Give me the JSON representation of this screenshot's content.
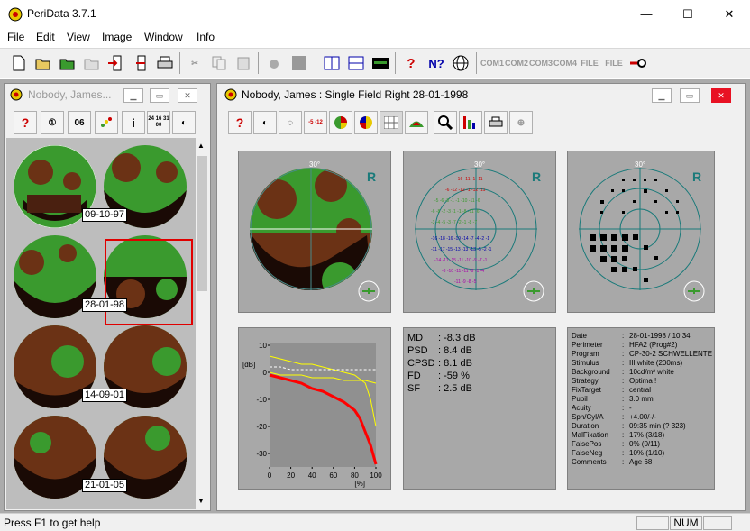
{
  "app": {
    "title": "PeriData 3.7.1"
  },
  "window_buttons": {
    "minimize": "—",
    "maximize": "☐",
    "close": "✕"
  },
  "menu": [
    "File",
    "Edit",
    "View",
    "Image",
    "Window",
    "Info"
  ],
  "toolbar": {
    "buttons": [
      "new",
      "open",
      "open-green",
      "open-disabled",
      "import",
      "export",
      "print",
      "cut",
      "copy",
      "paste",
      "delete",
      "stop",
      "tile-v",
      "tile-h",
      "monitor",
      "help",
      "context-help",
      "web"
    ],
    "com_buttons": [
      "COM1",
      "COM2",
      "COM3",
      "COM4",
      "FILE",
      "FILE",
      "key"
    ]
  },
  "left_window": {
    "title": "Nobody, James...",
    "toolbar_labels": [
      "?",
      "①",
      "06",
      "•",
      "i",
      "24 16 31 00",
      "◐"
    ],
    "dates": [
      "09-10-97",
      "28-01-98",
      "14-09-01",
      "21-01-05"
    ]
  },
  "right_window": {
    "title": "Nobody, James  :  Single Field  Right  28-01-1998",
    "toolbar_labels": [
      "?",
      "◐",
      "◌",
      "-5 -12",
      "◑",
      "◓",
      "▦",
      "▲",
      "🔍",
      "dB",
      "🖶",
      "⊕"
    ],
    "eye": "R",
    "degree_label": "30°",
    "stats": [
      {
        "label": "MD",
        "value": ":  -8.3 dB"
      },
      {
        "label": "PSD",
        "value": ":  8.4 dB"
      },
      {
        "label": "CPSD",
        "value": ":  8.1 dB"
      },
      {
        "label": "FD",
        "value": ":  -59 %"
      },
      {
        "label": "SF",
        "value": ":  2.5 dB"
      }
    ],
    "info": [
      {
        "k": "Date",
        "v": "28-01-1998 / 10:34"
      },
      {
        "k": "Perimeter",
        "v": "HFA2 (Prog#2)"
      },
      {
        "k": "Program",
        "v": "CP-30-2 SCHWELLENTE"
      },
      {
        "k": "Stimulus",
        "v": "III white (200ms)"
      },
      {
        "k": "Background",
        "v": "10cd/m² white"
      },
      {
        "k": "Strategy",
        "v": "Optima !"
      },
      {
        "k": "FixTarget",
        "v": "central"
      },
      {
        "k": "Pupil",
        "v": "3.0 mm"
      },
      {
        "k": "Acuity",
        "v": "-"
      },
      {
        "k": "Sph/Cyl/A",
        "v": "+4.00/-/-"
      },
      {
        "k": "Duration",
        "v": "09:35 min (? 323)"
      },
      {
        "k": "MalFixation",
        "v": "17% (3/18)"
      },
      {
        "k": "FalsePos",
        "v": "0% (0/11)"
      },
      {
        "k": "FalseNeg",
        "v": "10% (1/10)"
      },
      {
        "k": "Comments",
        "v": "Age 68"
      }
    ],
    "curve": {
      "ylabel": "[dB]",
      "xlabel": "[%]",
      "yticks": [
        "10",
        "0",
        "-10",
        "-20",
        "-30"
      ],
      "xticks": [
        "0",
        "20",
        "40",
        "60",
        "80",
        "100"
      ]
    }
  },
  "chart_data": {
    "type": "line",
    "ylabel": "[dB]",
    "xlabel": "[%]",
    "xlim": [
      0,
      100
    ],
    "ylim": [
      -35,
      11
    ],
    "series": [
      {
        "color": "#ff0000",
        "x": [
          0,
          10,
          20,
          30,
          40,
          50,
          60,
          70,
          80,
          85,
          90,
          95,
          100
        ],
        "y": [
          -1,
          -2,
          -3,
          -4,
          -6,
          -7,
          -9,
          -11,
          -14,
          -17,
          -22,
          -27,
          -34
        ]
      },
      {
        "color": "#ffff00",
        "x": [
          0,
          10,
          20,
          30,
          40,
          50,
          60,
          70,
          80,
          90,
          95,
          100
        ],
        "y": [
          6,
          5,
          4,
          3,
          3,
          2,
          1,
          0,
          -1,
          -4,
          -10,
          -20
        ]
      },
      {
        "color": "#ffff00",
        "x": [
          0,
          10,
          20,
          30,
          40,
          50,
          60,
          70,
          80,
          90,
          100
        ],
        "y": [
          0,
          -1,
          -1,
          -1,
          -2,
          -2,
          -2,
          -3,
          -3,
          -3,
          -4
        ]
      },
      {
        "color": "#ffffff",
        "x": [
          0,
          10,
          20,
          30,
          40,
          50,
          60,
          70,
          80,
          90,
          100
        ],
        "y": [
          2,
          2,
          1,
          1,
          1,
          1,
          1,
          1,
          1,
          1,
          1
        ]
      }
    ]
  },
  "statusbar": {
    "help": "Press F1 to get help",
    "num": "NUM"
  }
}
